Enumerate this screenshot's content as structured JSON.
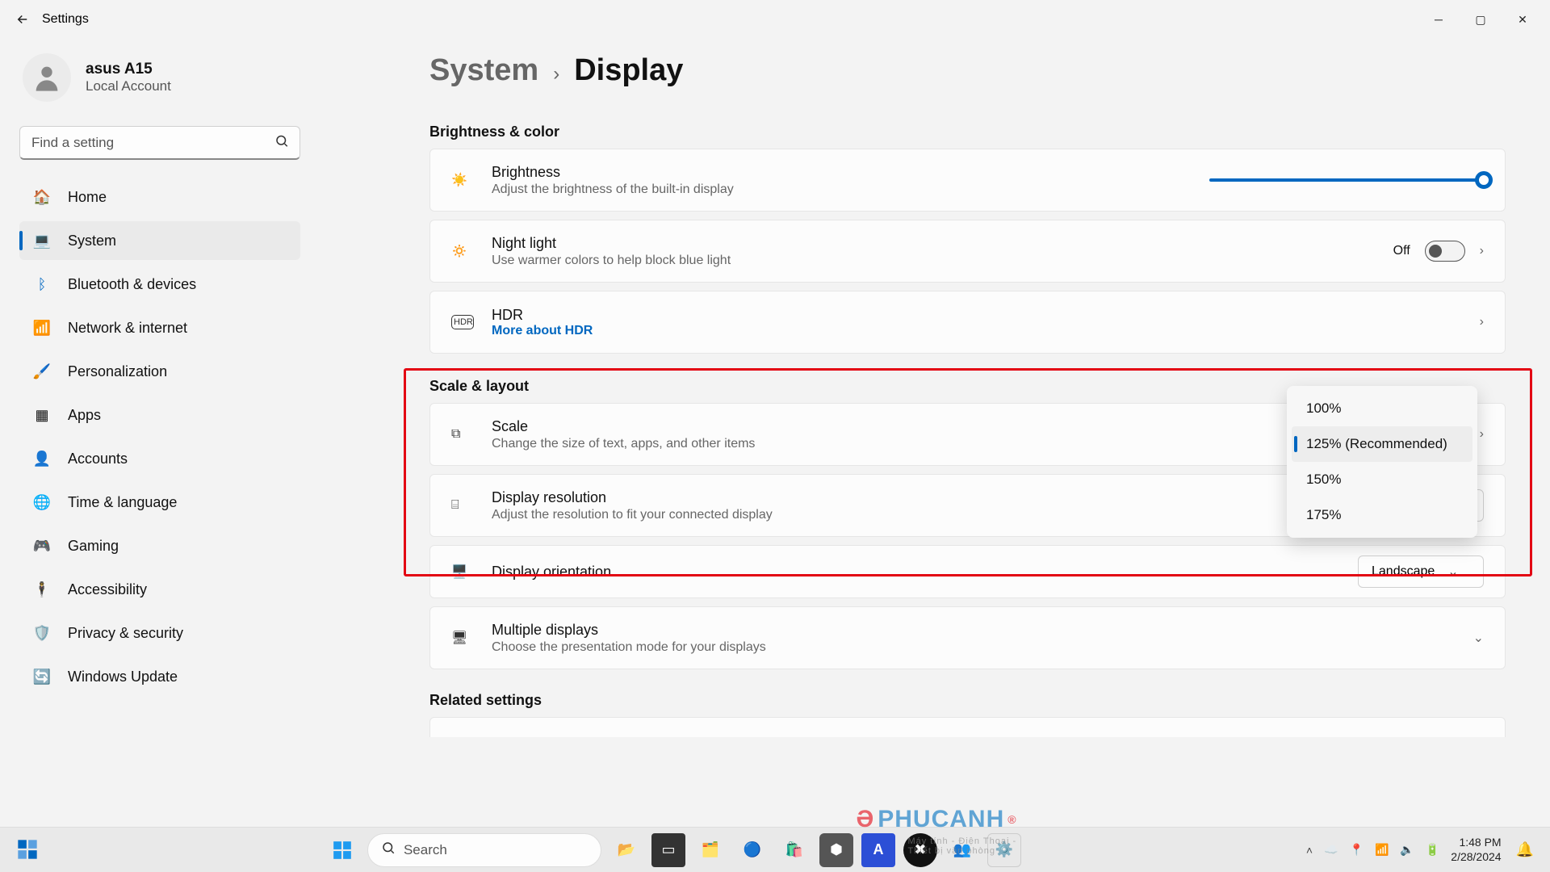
{
  "window": {
    "title": "Settings"
  },
  "profile": {
    "name": "asus A15",
    "sub": "Local Account"
  },
  "search": {
    "placeholder": "Find a setting"
  },
  "nav": {
    "home": "Home",
    "system": "System",
    "bluetooth": "Bluetooth & devices",
    "network": "Network & internet",
    "personalization": "Personalization",
    "apps": "Apps",
    "accounts": "Accounts",
    "time": "Time & language",
    "gaming": "Gaming",
    "accessibility": "Accessibility",
    "privacy": "Privacy & security",
    "wu": "Windows Update"
  },
  "breadcrumb": {
    "parent": "System",
    "current": "Display"
  },
  "sections": {
    "brightness_color": "Brightness & color",
    "scale_layout": "Scale & layout",
    "related": "Related settings"
  },
  "brightness": {
    "title": "Brightness",
    "sub": "Adjust the brightness of the built-in display"
  },
  "nightlight": {
    "title": "Night light",
    "sub": "Use warmer colors to help block blue light",
    "state_label": "Off"
  },
  "hdr": {
    "title": "HDR",
    "link": "More about HDR"
  },
  "scale": {
    "title": "Scale",
    "sub": "Change the size of text, apps, and other items",
    "options": {
      "o1": "100%",
      "o2": "125% (Recommended)",
      "o3": "150%",
      "o4": "175%"
    }
  },
  "resolution": {
    "title": "Display resolution",
    "sub": "Adjust the resolution to fit your connected display"
  },
  "orientation": {
    "title": "Display orientation",
    "value": "Landscape"
  },
  "multi": {
    "title": "Multiple displays",
    "sub": "Choose the presentation mode for your displays"
  },
  "taskbar": {
    "search": "Search",
    "time": "1:48 PM",
    "date": "2/28/2024"
  },
  "watermark": {
    "t": "PHUCANH",
    "sub": "Máy tính - Điện Thoại - Thiết bị văn phòng"
  }
}
